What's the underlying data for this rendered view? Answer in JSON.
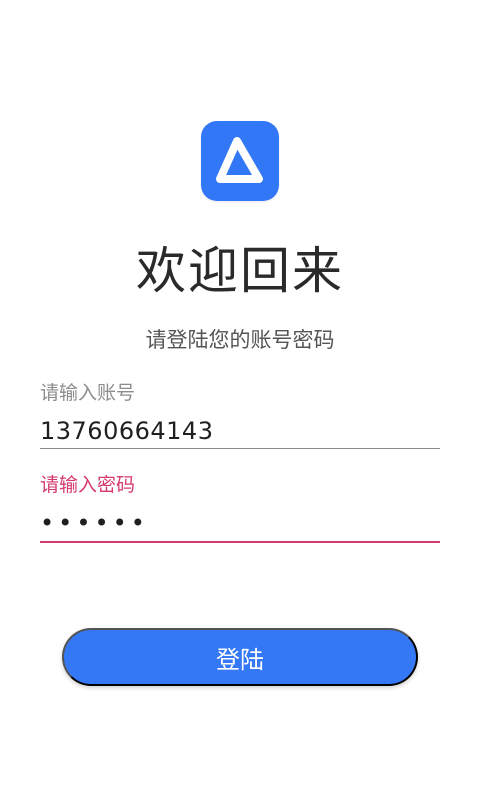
{
  "app": {
    "logo_icon": "app-triangle-logo-icon",
    "logo_color": "#3277f6"
  },
  "header": {
    "title": "欢迎回来",
    "subtitle": "请登陆您的账号密码"
  },
  "form": {
    "account": {
      "label": "请输入账号",
      "value": "13760664143"
    },
    "password": {
      "label": "请输入密码",
      "value": "••••••"
    },
    "accent_color": "#d53a6e"
  },
  "actions": {
    "login_label": "登陆",
    "button_color": "#3478f6"
  }
}
